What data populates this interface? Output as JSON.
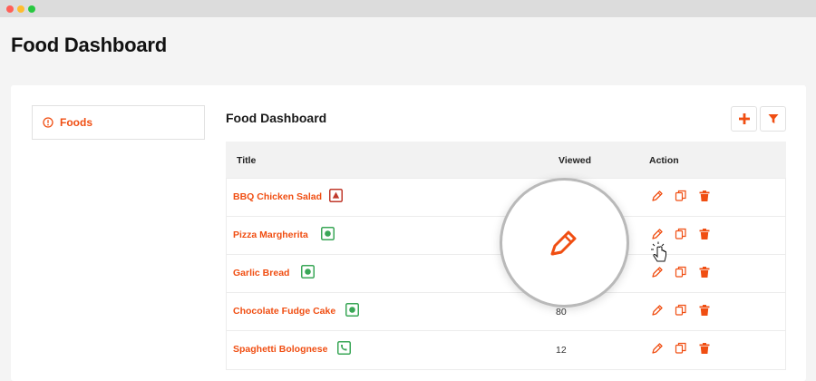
{
  "window": {
    "controls": [
      "close",
      "minimize",
      "maximize"
    ]
  },
  "page": {
    "title": "Food Dashboard"
  },
  "sidebar": {
    "items": [
      {
        "label": "Foods",
        "icon": "info-circle-icon",
        "active": true
      }
    ]
  },
  "main": {
    "title": "Food Dashboard",
    "toolbar": {
      "add_icon": "plus-icon",
      "filter_icon": "filter-icon"
    },
    "table": {
      "columns": [
        "Title",
        "Viewed",
        "Action"
      ],
      "rows": [
        {
          "title": "BBQ Chicken Salad",
          "badge": "triangle-badge-icon",
          "viewed": ""
        },
        {
          "title": "Pizza Margherita",
          "badge": "dot-badge-icon",
          "viewed": ""
        },
        {
          "title": "Garlic Bread",
          "badge": "dot-badge-icon",
          "viewed": ""
        },
        {
          "title": "Chocolate Fudge Cake",
          "badge": "dot-badge-icon",
          "viewed": "80"
        },
        {
          "title": "Spaghetti Bolognese",
          "badge": "leaf-badge-icon",
          "viewed": "12"
        }
      ],
      "actions": [
        "edit-icon",
        "copy-icon",
        "delete-icon"
      ]
    }
  },
  "colors": {
    "accent": "#f04e12",
    "veg_badge": "#3aa757",
    "nonveg_badge": "#c0392b"
  }
}
